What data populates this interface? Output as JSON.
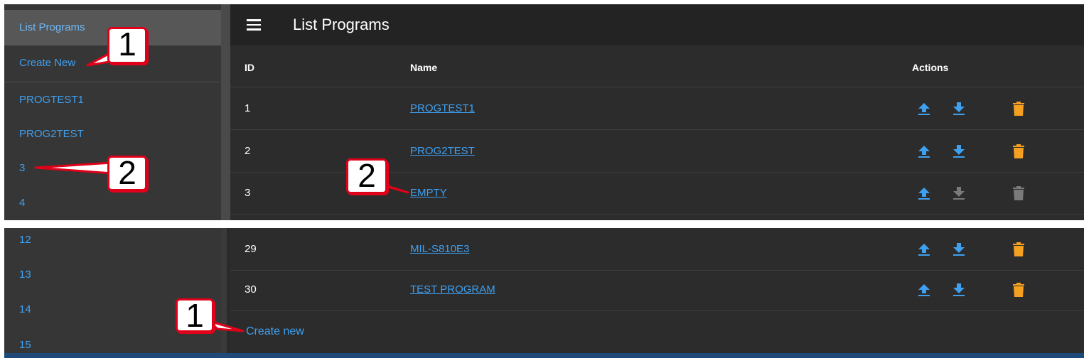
{
  "top": {
    "sidebar": {
      "items": [
        {
          "label": "List Programs",
          "active": true
        },
        {
          "label": "Create New"
        },
        {
          "label": "PROGTEST1"
        },
        {
          "label": "PROG2TEST"
        },
        {
          "label": "3"
        },
        {
          "label": "4"
        }
      ]
    },
    "appbar": {
      "title": "List Programs",
      "menu_icon": "hamburger-menu-icon"
    },
    "table": {
      "headers": {
        "id": "ID",
        "name": "Name",
        "actions": "Actions"
      },
      "rows": [
        {
          "id": "1",
          "name": "PROGTEST1",
          "download_enabled": true,
          "delete_enabled": true
        },
        {
          "id": "2",
          "name": "PROG2TEST",
          "download_enabled": true,
          "delete_enabled": true
        },
        {
          "id": "3",
          "name": "EMPTY",
          "download_enabled": false,
          "delete_enabled": false
        }
      ]
    }
  },
  "bottom": {
    "sidebar": {
      "items": [
        {
          "label": "12"
        },
        {
          "label": "13"
        },
        {
          "label": "14"
        },
        {
          "label": "15"
        }
      ]
    },
    "table": {
      "rows": [
        {
          "id": "29",
          "name": "MIL-S810E3",
          "download_enabled": true,
          "delete_enabled": true
        },
        {
          "id": "30",
          "name": "TEST PROGRAM",
          "download_enabled": true,
          "delete_enabled": true
        }
      ],
      "create_new": "Create new"
    }
  },
  "callouts": [
    {
      "label": "1"
    },
    {
      "label": "2"
    },
    {
      "label": "2"
    },
    {
      "label": "1"
    }
  ],
  "colors": {
    "link": "#3fa0f0",
    "upload_icon": "#3fa0f0",
    "download_icon": "#3fa0f0",
    "delete_icon": "#f5a020",
    "disabled_icon": "#7a7a7a",
    "callout_border": "#e0001a"
  },
  "icons": {
    "upload": "upload-icon",
    "download": "download-icon",
    "delete": "trash-icon"
  }
}
